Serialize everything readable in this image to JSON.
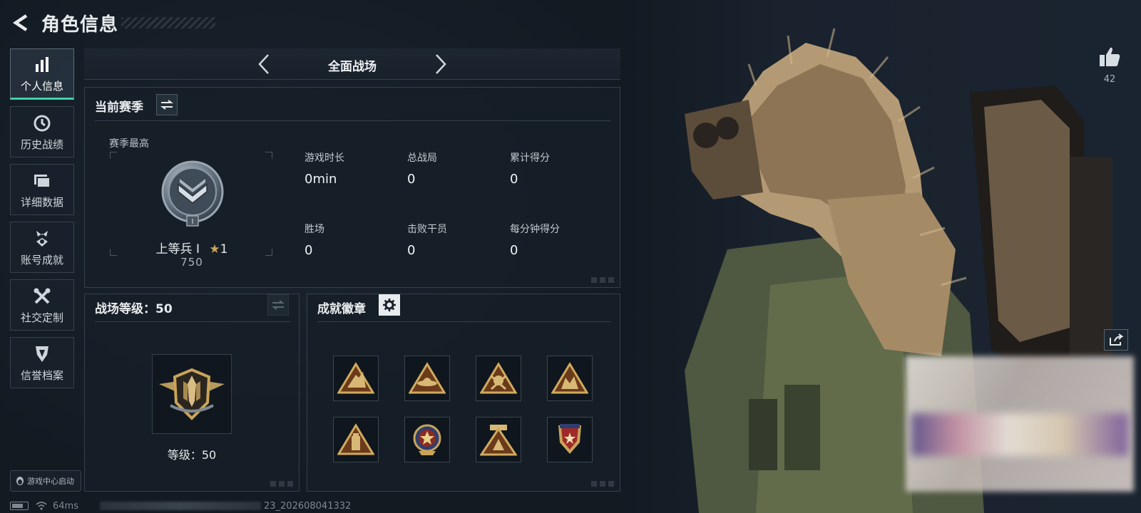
{
  "header": {
    "title": "角色信息"
  },
  "sidebar": {
    "items": [
      {
        "label": "个人信息",
        "icon": "bar-chart-icon",
        "active": true
      },
      {
        "label": "历史战绩",
        "icon": "history-icon",
        "active": false
      },
      {
        "label": "详细数据",
        "icon": "folders-icon",
        "active": false
      },
      {
        "label": "账号成就",
        "icon": "achievement-icon",
        "active": false
      },
      {
        "label": "社交定制",
        "icon": "tools-icon",
        "active": false
      },
      {
        "label": "信誉档案",
        "icon": "credit-icon",
        "active": false
      }
    ],
    "launch_label": "游戏中心启动"
  },
  "mode_bar": {
    "title": "全面战场"
  },
  "season": {
    "title": "当前赛季",
    "best_label": "赛季最高",
    "rank_name": "上等兵 Ⅰ",
    "rank_stars": "1",
    "rank_points": "750",
    "rank_roman": "Ⅰ",
    "stats": [
      {
        "label": "游戏时长",
        "value": "0min"
      },
      {
        "label": "总战局",
        "value": "0"
      },
      {
        "label": "累计得分",
        "value": "0"
      },
      {
        "label": "胜场",
        "value": "0"
      },
      {
        "label": "击败干员",
        "value": "0"
      },
      {
        "label": "每分钟得分",
        "value": "0"
      }
    ]
  },
  "battlefield_level": {
    "title": "战场等级：50",
    "level_text": "等级：50"
  },
  "achievements": {
    "title": "成就徽章",
    "badges": [
      "triangle-badge-rockets",
      "triangle-badge-hat",
      "triangle-badge-skull",
      "triangle-badge-soldiers",
      "triangle-badge-tower",
      "star-medal-badge",
      "triangle-badge-emblem",
      "shield-star-badge"
    ]
  },
  "profile": {
    "likes": "42"
  },
  "status_bar": {
    "ping": "64ms",
    "code": "23_202608041332"
  },
  "colors": {
    "accent": "#3fd2a8",
    "panel_border": "#33404b",
    "gold": "#c9a45a"
  }
}
